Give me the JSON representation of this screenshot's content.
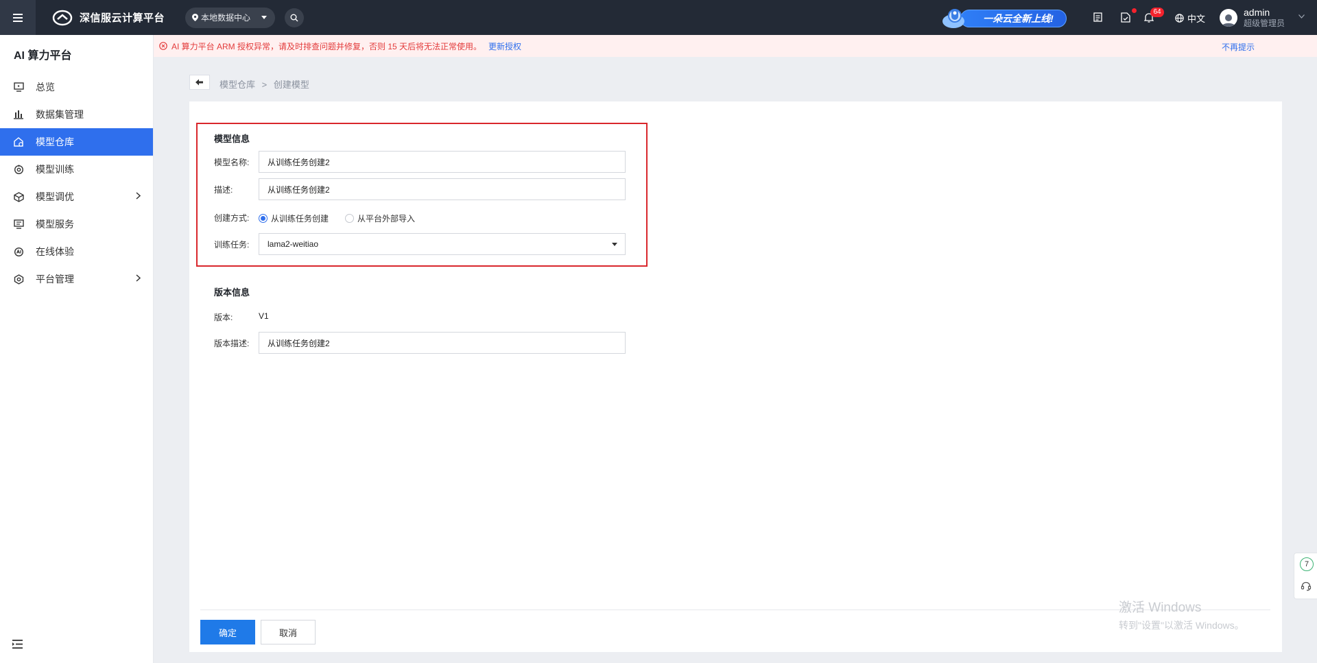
{
  "topbar": {
    "brand": "深信服云计算平台",
    "datacenter": "本地数据中心",
    "promo": "一朵云全新上线!",
    "notification_count": "64",
    "language": "中文",
    "user_name": "admin",
    "user_role": "超级管理员"
  },
  "sidebar": {
    "title": "AI 算力平台",
    "items": [
      {
        "label": "总览",
        "icon": "monitor-icon"
      },
      {
        "label": "数据集管理",
        "icon": "bar-chart-icon"
      },
      {
        "label": "模型仓库",
        "icon": "model-repo-icon",
        "active": true
      },
      {
        "label": "模型训练",
        "icon": "training-icon"
      },
      {
        "label": "模型调优",
        "icon": "cube-icon",
        "expandable": true
      },
      {
        "label": "模型服务",
        "icon": "service-icon"
      },
      {
        "label": "在线体验",
        "icon": "experience-icon"
      },
      {
        "label": "平台管理",
        "icon": "settings-hex-icon",
        "expandable": true
      }
    ]
  },
  "alert": {
    "text": "AI 算力平台 ARM 授权异常，请及时排查问题并修复，否则 15 天后将无法正常使用。",
    "link": "更新授权",
    "dismiss": "不再提示"
  },
  "breadcrumb": {
    "parent": "模型仓库",
    "separator": ">",
    "current": "创建模型"
  },
  "model_info": {
    "title": "模型信息",
    "name_label": "模型名称:",
    "name_value": "从训练任务创建2",
    "desc_label": "描述:",
    "desc_value": "从训练任务创建2",
    "method_label": "创建方式:",
    "method_options": [
      "从训练任务创建",
      "从平台外部导入"
    ],
    "method_selected": "从训练任务创建",
    "task_label": "训练任务:",
    "task_value": "lama2-weitiao"
  },
  "version_info": {
    "title": "版本信息",
    "version_label": "版本:",
    "version_value": "V1",
    "version_desc_label": "版本描述:",
    "version_desc_value": "从训练任务创建2"
  },
  "actions": {
    "confirm": "确定",
    "cancel": "取消"
  },
  "watermark": {
    "title": "激活 Windows",
    "subtitle": "转到\"设置\"以激活 Windows。"
  },
  "float_tools": {
    "count": "7"
  },
  "colors": {
    "topbar_bg": "#232a36",
    "accent": "#2f6fed",
    "alert_text": "#e33b3b",
    "highlight_border": "#d9262b"
  }
}
